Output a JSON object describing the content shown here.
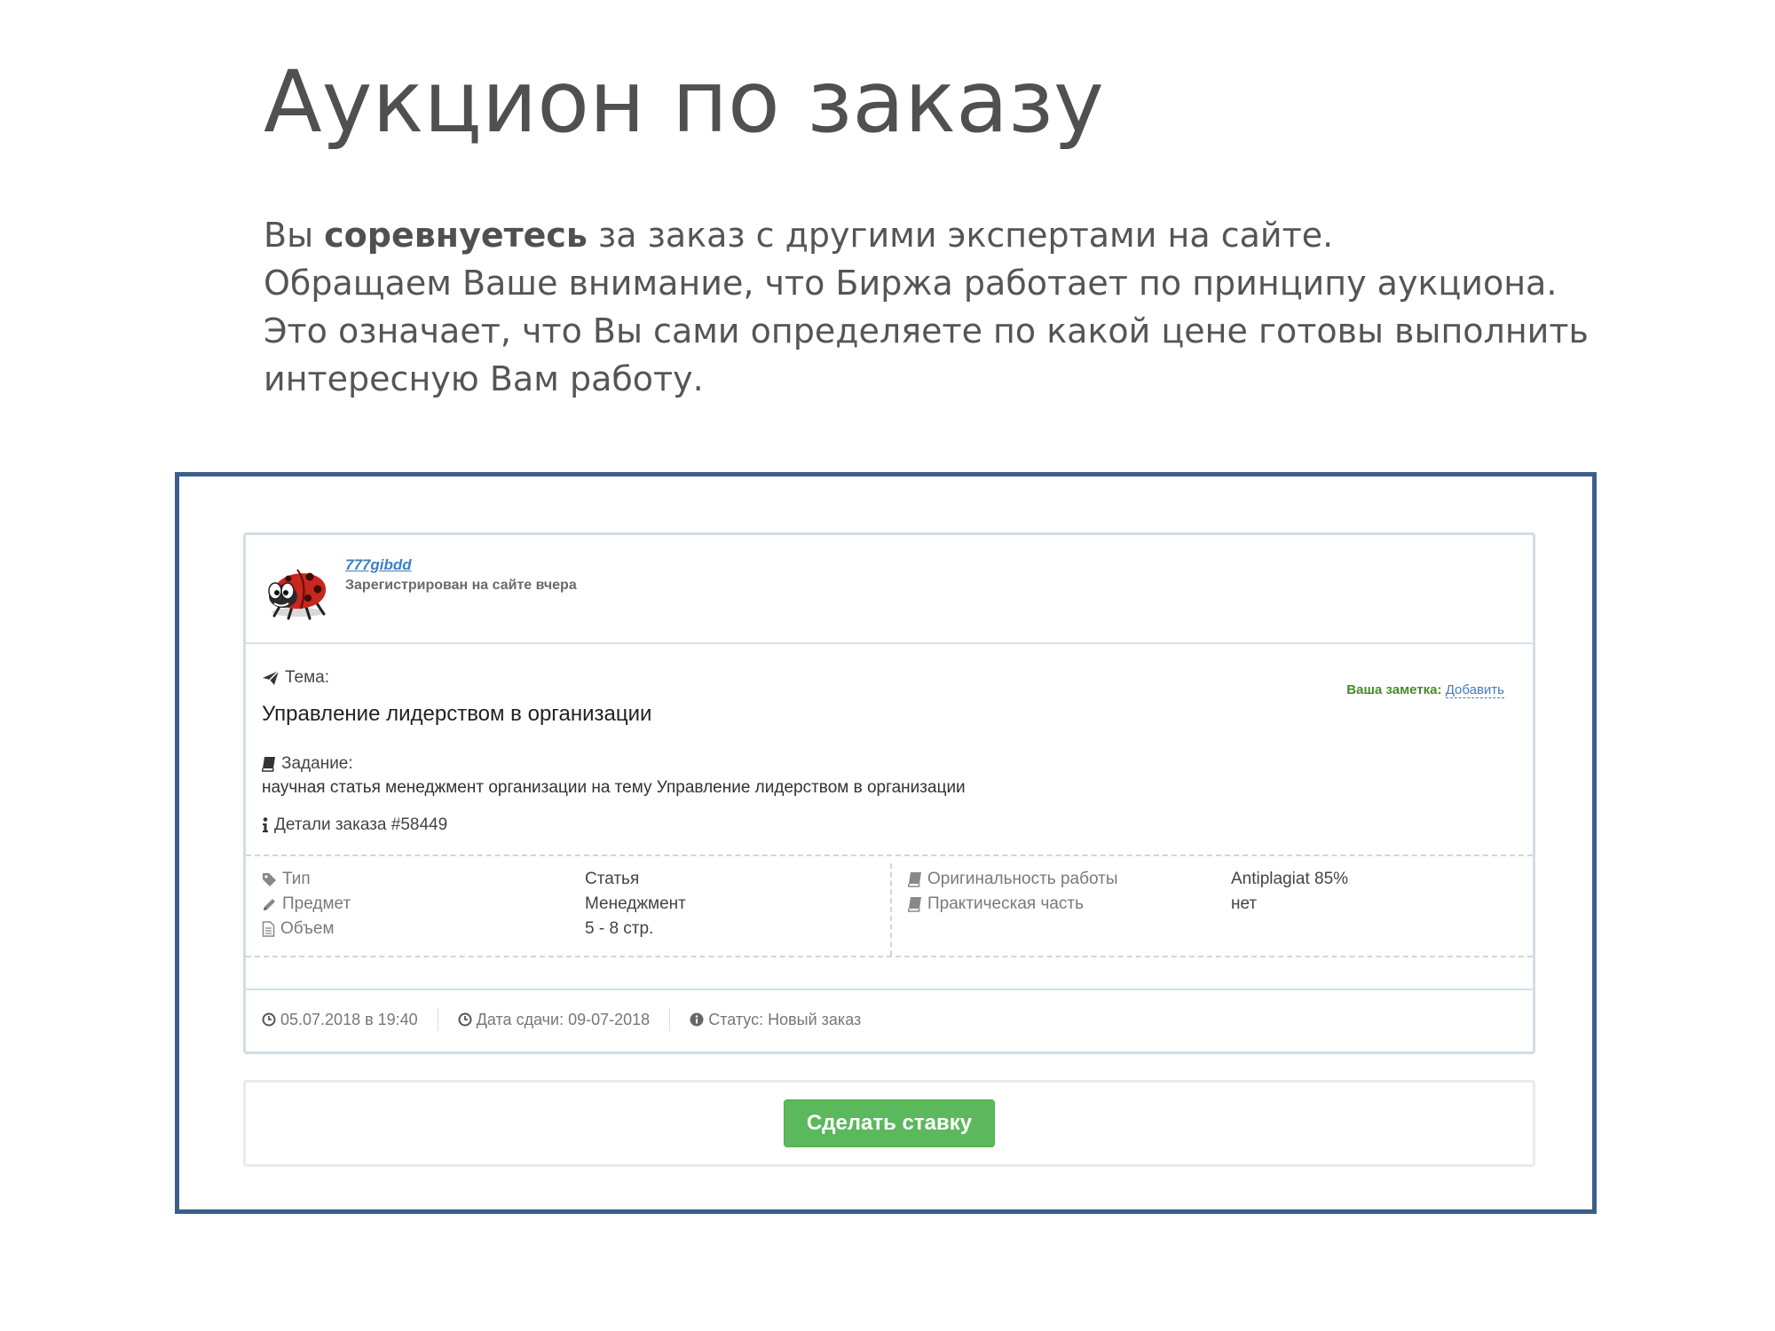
{
  "slide": {
    "title": "Аукцион по заказу",
    "intro_before": "Вы ",
    "intro_bold": "соревнуетесь",
    "intro_after": " за заказ с другими экспертами на сайте.",
    "line2": "Обращаем Ваше внимание, что Биржа работает по принципу аукциона.",
    "line3": "Это означает, что Вы сами определяете по какой цене готовы выполнить",
    "line4": "интересную Вам работу."
  },
  "order": {
    "user": {
      "name": "777gibdd",
      "registered": "Зарегистрирован на сайте вчера",
      "avatar_icon": "ladybug-avatar"
    },
    "topic_label": "Тема:",
    "topic": "Управление лидерством в организации",
    "note_label": "Ваша заметка:",
    "note_link": "Добавить",
    "task_label": "Задание:",
    "task": "научная статья менеджмент организации на тему Управление лидерством в организации",
    "details": "Детали заказа #58449",
    "props_left": [
      {
        "icon": "tag-icon",
        "name": "Тип",
        "value": "Статья"
      },
      {
        "icon": "pencil-icon",
        "name": "Предмет",
        "value": "Менеджмент"
      },
      {
        "icon": "file-icon",
        "name": "Объем",
        "value": "5 - 8 стр."
      }
    ],
    "props_right": [
      {
        "icon": "book-icon",
        "name": "Оригинальность работы",
        "value": "Antiplagiat 85%"
      },
      {
        "icon": "book-icon",
        "name": "Практическая часть",
        "value": "нет"
      }
    ],
    "footer": {
      "created": "05.07.2018 в 19:40",
      "deadline": "Дата сдачи: 09-07-2018",
      "status": "Статус: Новый заказ"
    }
  },
  "bid": {
    "button_label": "Сделать ставку"
  },
  "colors": {
    "frame": "#3b5e8c",
    "button": "#5cb85c",
    "link": "#3d7fc2",
    "note_label": "#4a8a2a"
  }
}
